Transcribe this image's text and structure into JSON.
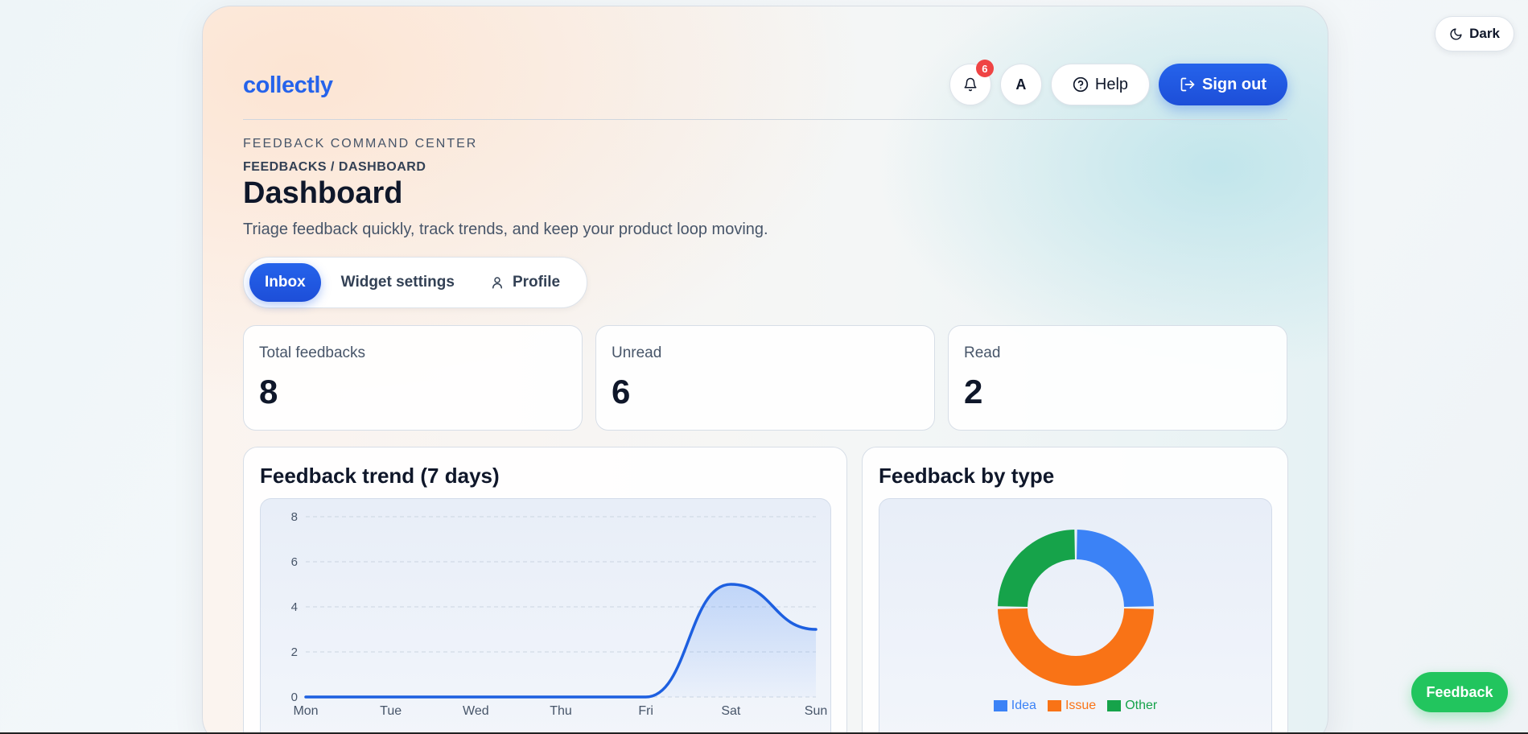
{
  "app": {
    "logo": "collectly"
  },
  "header": {
    "notifications_count": "6",
    "avatar_initial": "A",
    "help_label": "Help",
    "signout_label": "Sign out"
  },
  "page": {
    "eyebrow": "FEEDBACK COMMAND CENTER",
    "breadcrumb": "FEEDBACKS / DASHBOARD",
    "title": "Dashboard",
    "subtitle": "Triage feedback quickly, track trends, and keep your product loop moving."
  },
  "tabs": [
    {
      "label": "Inbox",
      "active": true
    },
    {
      "label": "Widget settings",
      "active": false
    },
    {
      "label": "Profile",
      "active": false,
      "icon": "user-icon"
    }
  ],
  "stats": [
    {
      "label": "Total feedbacks",
      "value": "8"
    },
    {
      "label": "Unread",
      "value": "6"
    },
    {
      "label": "Read",
      "value": "2"
    }
  ],
  "trend_panel": {
    "title": "Feedback trend (7 days)"
  },
  "type_panel": {
    "title": "Feedback by type"
  },
  "theme_toggle": {
    "label": "Dark",
    "icon": "moon-icon"
  },
  "feedback_fab": {
    "label": "Feedback"
  },
  "colors": {
    "primary": "#2563eb",
    "idea": "#3b82f6",
    "issue": "#f97316",
    "other": "#16a34a",
    "fab": "#22c55e",
    "badge": "#ef4444"
  },
  "chart_data": [
    {
      "type": "line",
      "categories": [
        "Mon",
        "Tue",
        "Wed",
        "Thu",
        "Fri",
        "Sat",
        "Sun"
      ],
      "series": [
        {
          "values": [
            0,
            0,
            0,
            0,
            0,
            5,
            3
          ]
        }
      ],
      "yticks": [
        0,
        2,
        4,
        6,
        8
      ],
      "ylim": [
        0,
        8
      ],
      "grid": true,
      "area_fill": true
    },
    {
      "type": "pie",
      "donut": true,
      "labels": [
        "Idea",
        "Issue",
        "Other"
      ],
      "values": [
        2,
        4,
        2
      ],
      "legend": "bottom"
    }
  ]
}
